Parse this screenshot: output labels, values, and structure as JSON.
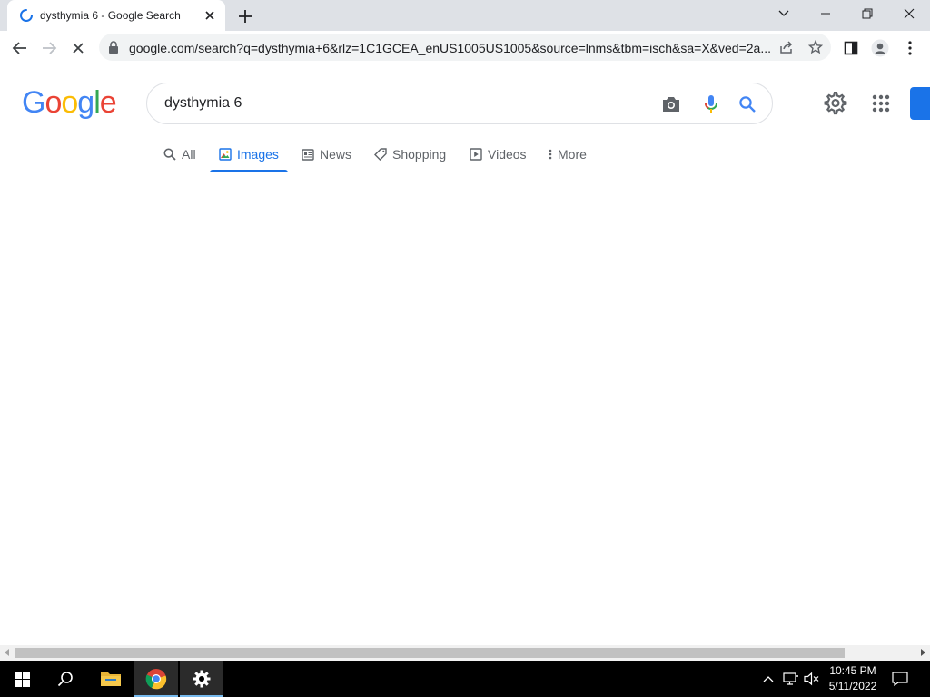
{
  "browser": {
    "tab": {
      "title": "dysthymia 6 - Google Search",
      "spinner_color": "#1a73e8"
    },
    "new_tab_icon": "plus-icon",
    "window_controls": [
      "chevron-down-icon",
      "minimize-icon",
      "restore-icon",
      "close-icon"
    ],
    "address": "google.com/search?q=dysthymia+6&rlz=1C1GCEA_enUS1005US1005&source=lnms&tbm=isch&sa=X&ved=2a..."
  },
  "google": {
    "logo_letters": [
      {
        "ch": "G",
        "color": "#4285f4"
      },
      {
        "ch": "o",
        "color": "#ea4335"
      },
      {
        "ch": "o",
        "color": "#fbbc05"
      },
      {
        "ch": "g",
        "color": "#4285f4"
      },
      {
        "ch": "l",
        "color": "#34a853"
      },
      {
        "ch": "e",
        "color": "#ea4335"
      }
    ],
    "query": "dysthymia 6",
    "tabs": [
      {
        "label": "All",
        "icon": "search-icon",
        "active": false
      },
      {
        "label": "Images",
        "icon": "image-icon",
        "active": true
      },
      {
        "label": "News",
        "icon": "news-icon",
        "active": false
      },
      {
        "label": "Shopping",
        "icon": "tag-icon",
        "active": false
      },
      {
        "label": "Videos",
        "icon": "play-icon",
        "active": false
      },
      {
        "label": "More",
        "icon": "more-vertical-icon",
        "active": false
      }
    ],
    "accent_color": "#1a73e8"
  },
  "taskbar": {
    "time": "10:45 PM",
    "date": "5/11/2022"
  }
}
